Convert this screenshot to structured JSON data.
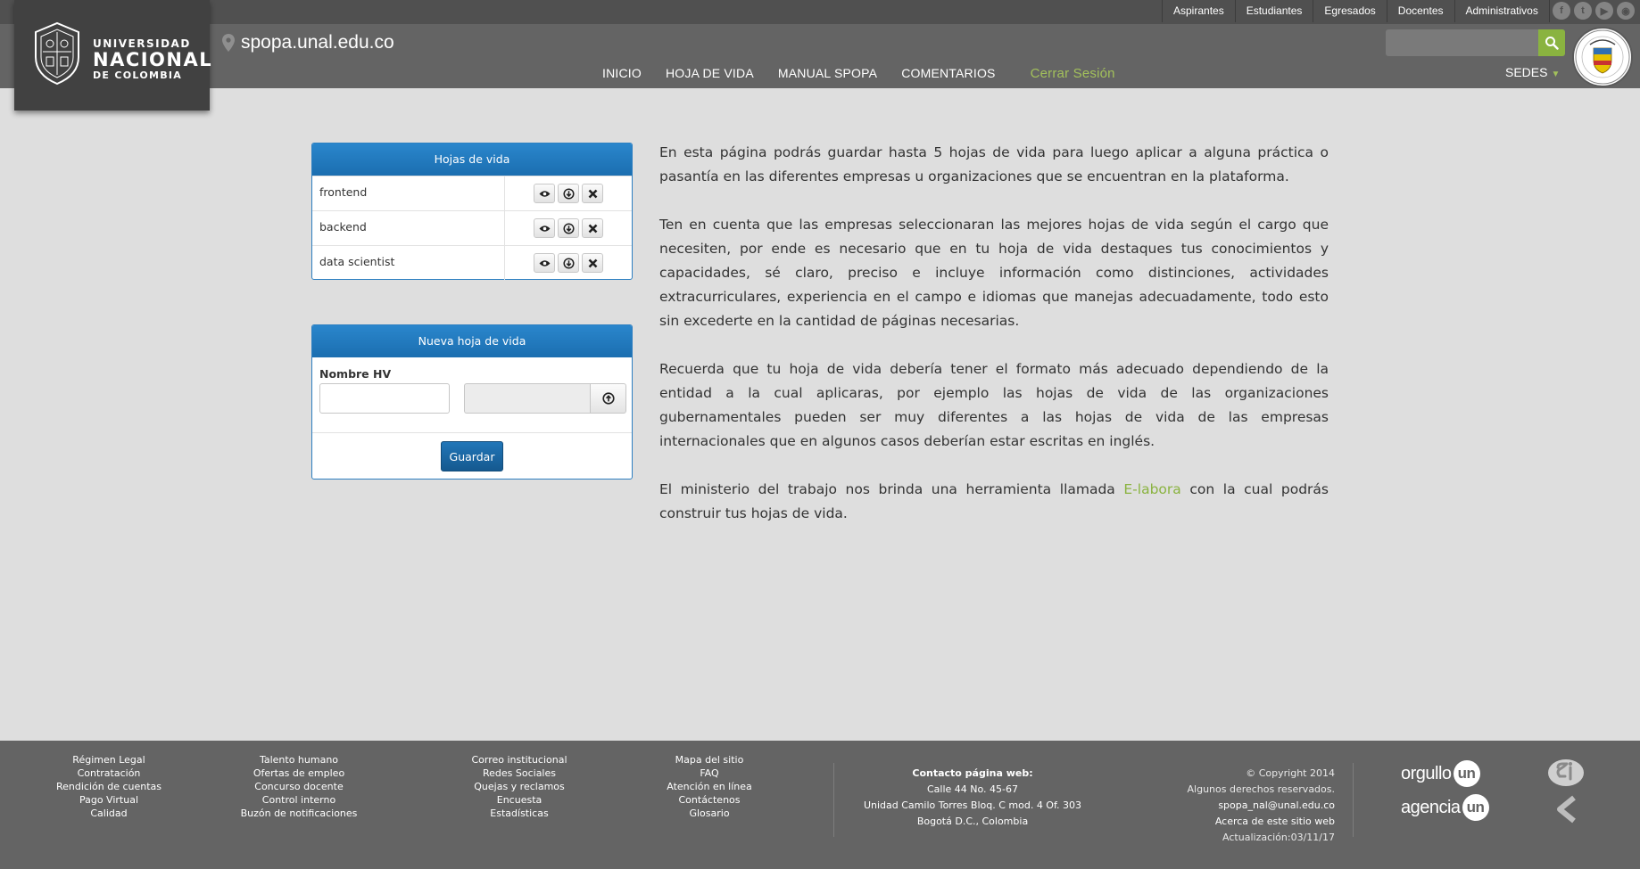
{
  "header": {
    "logo": {
      "line1": "UNIVERSIDAD",
      "line2": "NACIONAL",
      "line3": "DE COLOMBIA"
    },
    "site_url": "spopa.unal.edu.co",
    "top_links": [
      "Aspirantes",
      "Estudiantes",
      "Egresados",
      "Docentes",
      "Administrativos"
    ],
    "social_icons": [
      "facebook-icon",
      "twitter-icon",
      "youtube-icon",
      "rss-icon"
    ],
    "search": {
      "placeholder": ""
    },
    "nav": {
      "inicio": "INICIO",
      "hoja_de_vida": "HOJA DE VIDA",
      "manual": "MANUAL SPOPA",
      "comentarios": "COMENTARIOS",
      "logout": "Cerrar Sesión"
    },
    "sedes": "SEDES"
  },
  "cv_panel": {
    "title": "Hojas de vida",
    "rows": [
      {
        "name": "frontend"
      },
      {
        "name": "backend"
      },
      {
        "name": "data scientist"
      }
    ]
  },
  "new_panel": {
    "title": "Nueva hoja de vida",
    "name_label": "Nombre HV",
    "name_value": "",
    "file_value": "",
    "save_label": "Guardar"
  },
  "info": {
    "p1": "En esta página podrás guardar hasta 5 hojas de vida para luego aplicar a alguna práctica o pasantía en las diferentes empresas u organizaciones que se encuentran en la plataforma.",
    "p2": "Ten en cuenta que las empresas seleccionaran las mejores hojas de vida según el cargo que necesiten, por ende es necesario que en tu hoja de vida destaques tus conocimientos y capacidades, sé claro, preciso e incluye información como distinciones, actividades extracurriculares, experiencia en el campo e idiomas que manejas adecuadamente, todo esto sin excederte en la cantidad de páginas necesarias.",
    "p3": "Recuerda que tu hoja de vida debería tener el formato más adecuado dependiendo de la entidad a la cual aplicaras, por ejemplo las hojas de vida de las organizaciones gubernamentales pueden ser muy diferentes a las hojas de vida de las empresas internacionales que en algunos casos deberían estar escritas en inglés.",
    "p4_before": "El ministerio del trabajo nos brinda una herramienta llamada ",
    "p4_link": "E-labora",
    "p4_after": " con la cual podrás construir tus hojas de vida."
  },
  "footer": {
    "col1": [
      "Régimen Legal",
      "Contratación",
      "Rendición de cuentas",
      "Pago Virtual",
      "Calidad"
    ],
    "col2": [
      "Talento humano",
      "Ofertas de empleo",
      "Concurso docente",
      "Control interno",
      "Buzón de notificaciones"
    ],
    "col3": [
      "Correo institucional",
      "Redes Sociales",
      "Quejas y reclamos",
      "Encuesta",
      "Estadísticas"
    ],
    "col4": [
      "Mapa del sitio",
      "FAQ",
      "Atención en línea",
      "Contáctenos",
      "Glosario"
    ],
    "contact": {
      "heading": "Contacto página web:",
      "address": "Calle 44 No. 45-67",
      "building": "Unidad Camilo Torres Bloq. C mod. 4 Of. 303",
      "city": "Bogotá D.C., Colombia"
    },
    "rights": {
      "copyright": "© Copyright 2014",
      "reserved": "Algunos derechos reservados.",
      "email": "spopa_nal@unal.edu.co",
      "about": "Acerca de este sitio web",
      "updated": "Actualización:03/11/17"
    },
    "brand1": {
      "word": "orgullo",
      "mark": "un"
    },
    "brand2": {
      "word": "agencia",
      "mark": "un"
    }
  },
  "colors": {
    "accent_green": "#8ab340",
    "panel_blue": "#1b6eb0",
    "header_gray": "#646464"
  }
}
